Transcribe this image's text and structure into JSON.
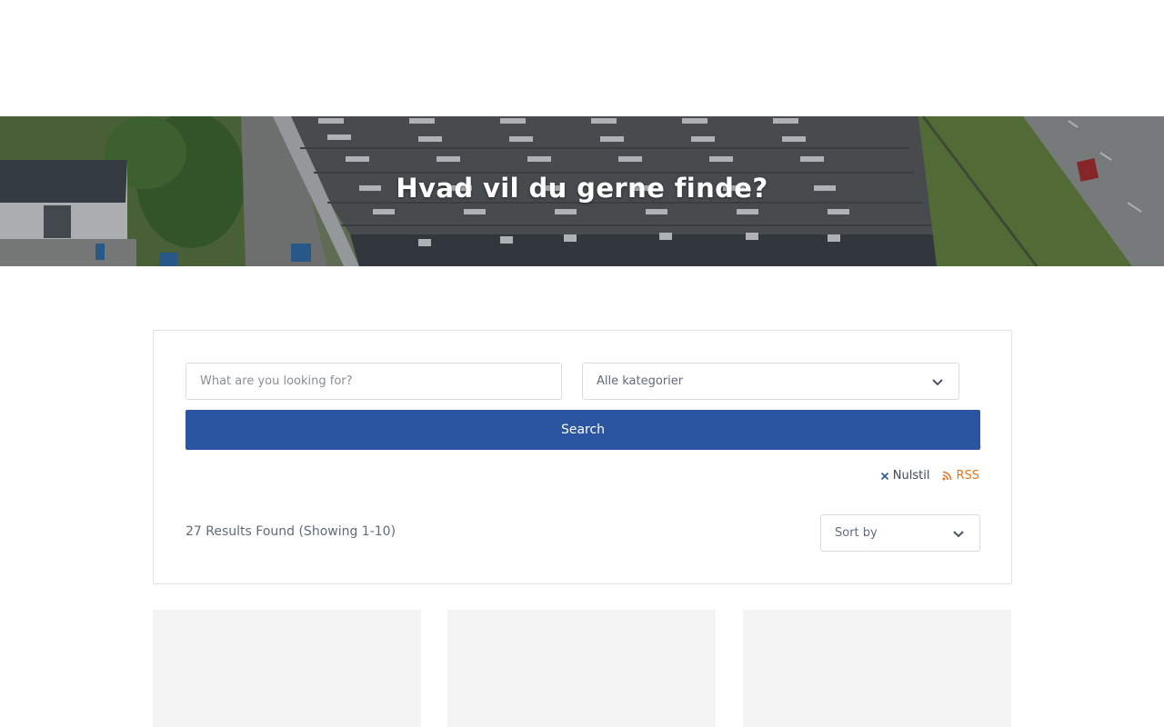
{
  "hero": {
    "title": "Hvad vil du gerne finde?"
  },
  "search": {
    "placeholder": "What are you looking for?",
    "category_value": "Alle kategorier",
    "button_label": "Search"
  },
  "links": {
    "reset_label": "Nulstil",
    "rss_label": "RSS"
  },
  "results": {
    "summary": "27 Results Found (Showing 1-10)",
    "sort_placeholder": "Sort by"
  },
  "colors": {
    "primary": "#2b55a1",
    "rss": "#e8731e",
    "text": "#5f6b7a"
  },
  "icons": {
    "reset": "close-icon",
    "rss": "rss-icon",
    "dropdown": "chevron-down-icon"
  }
}
